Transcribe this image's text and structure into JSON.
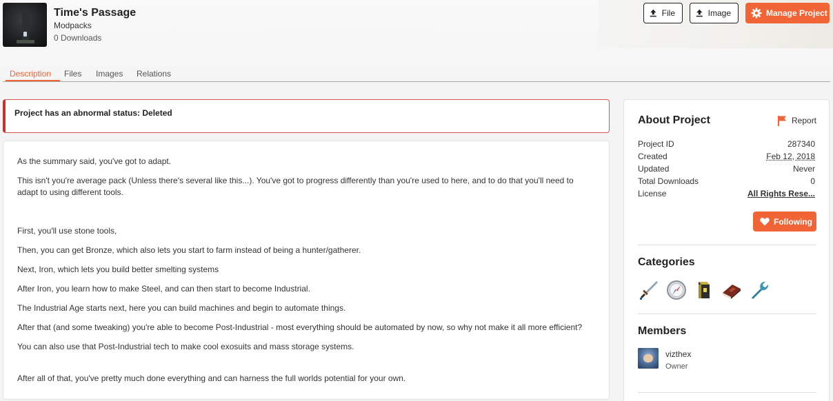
{
  "project": {
    "title": "Time's Passage",
    "category": "Modpacks",
    "downloads": "0 Downloads"
  },
  "actions": {
    "file_label": "File",
    "image_label": "Image",
    "manage_label": "Manage Project"
  },
  "tabs": [
    {
      "label": "Description",
      "active": true
    },
    {
      "label": "Files"
    },
    {
      "label": "Images"
    },
    {
      "label": "Relations"
    }
  ],
  "alert": {
    "text": "Project has an abnormal status: Deleted"
  },
  "description": {
    "lines": [
      "As the summary said, you've got to adapt.",
      "This isn't you're average pack (Unless there's several like this...). You've got to progress differently than you're used to here, and to do that you'll need to",
      "adapt to using different tools.",
      "First, you'll use stone tools,",
      "Then, you can get Bronze, which also lets you start to farm instead of being a hunter/gatherer.",
      "Next, Iron, which lets you build better smelting systems",
      "After Iron, you learn how to make Steel, and can then start to become Industrial.",
      "The Industrial Age starts next, here you can build machines and begin to automate things.",
      "After that (and some tweaking) you're able to become Post-Industrial - most everything should be automated by now, so why not make it all more efficient?",
      "You can also use that Post-Industrial tech to make cool exosuits and mass storage systems.",
      "After all of that, you've pretty much done everything and can harness the full worlds potential for your own."
    ]
  },
  "about": {
    "title": "About Project",
    "report_label": "Report",
    "rows": [
      {
        "label": "Project ID",
        "value": "287340"
      },
      {
        "label": "Created",
        "value": "Feb 12, 2018"
      },
      {
        "label": "Updated",
        "value": "Never"
      },
      {
        "label": "Total Downloads",
        "value": "0"
      },
      {
        "label": "License",
        "value": "All Rights Rese..."
      }
    ],
    "follow_label": "Following"
  },
  "categories": {
    "title": "Categories",
    "icons": [
      "sword-icon",
      "compass-icon",
      "block-icon",
      "book-icon",
      "wrench-icon"
    ]
  },
  "members": {
    "title": "Members",
    "list": [
      {
        "name": "vizthex",
        "role": "Owner"
      }
    ]
  },
  "colors": {
    "accent": "#f16436",
    "alert_border": "#c9302c"
  }
}
